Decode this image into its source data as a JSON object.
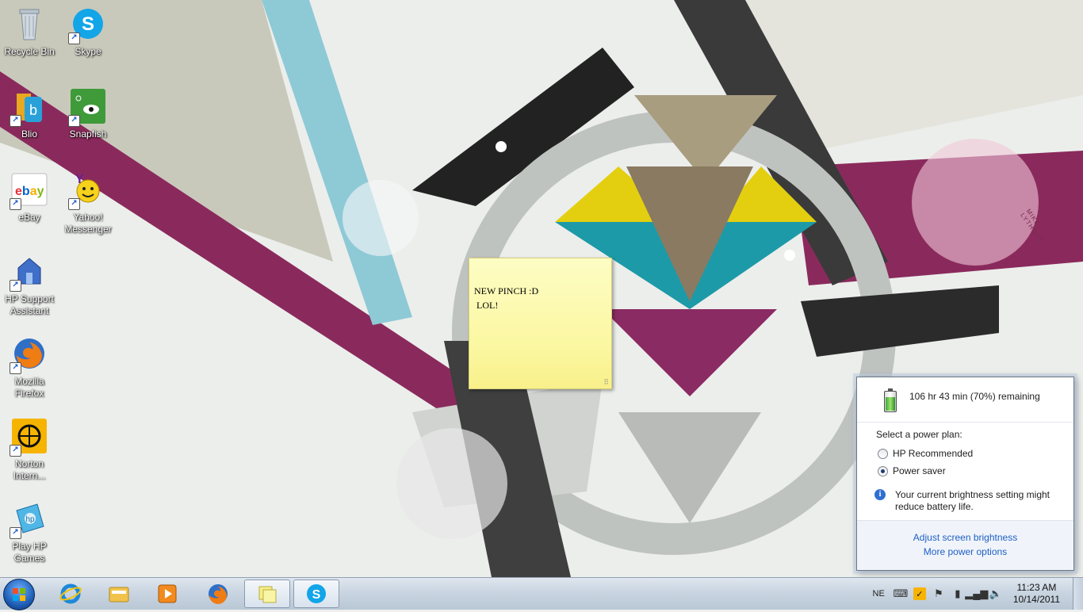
{
  "desktop_icons": [
    {
      "label": "Recycle Bin",
      "icon": "recycle-bin-icon"
    },
    {
      "label": "Skype",
      "icon": "skype-icon"
    },
    {
      "label": "Blio",
      "icon": "blio-icon"
    },
    {
      "label": "Snapfish",
      "icon": "snapfish-icon"
    },
    {
      "label": "eBay",
      "icon": "ebay-icon"
    },
    {
      "label": "Yahoo!\nMessenger",
      "icon": "yahoo-messenger-icon"
    },
    {
      "label": "HP Support\nAssistant",
      "icon": "hp-support-icon"
    },
    {
      "label": "Mozilla\nFirefox",
      "icon": "firefox-icon"
    },
    {
      "label": "Norton\nIntern...",
      "icon": "norton-icon"
    },
    {
      "label": "Play HP\nGames",
      "icon": "hp-games-icon"
    }
  ],
  "sticky_note": {
    "text": "NEW PINCH :D\n LOL!"
  },
  "wallpaper": {
    "signature": "MIKE LYTHGOE"
  },
  "power_flyout": {
    "remaining": "106 hr 43 min (70%) remaining",
    "battery_percent": 70,
    "select_label": "Select a power plan:",
    "plans": [
      {
        "label": "HP Recommended",
        "selected": false
      },
      {
        "label": "Power saver",
        "selected": true
      }
    ],
    "info_text": "Your current brightness setting might reduce battery life.",
    "link_brightness": "Adjust screen brightness",
    "link_more": "More power options"
  },
  "taskbar": {
    "pinned": [
      "internet-explorer-icon",
      "windows-explorer-icon",
      "media-player-icon",
      "firefox-icon",
      "sticky-notes-icon",
      "skype-icon"
    ],
    "tray": {
      "language": "NE",
      "time": "11:23 AM",
      "date": "10/14/2011"
    }
  },
  "colors": {
    "accent": "#1f5fc4",
    "taskbar": "#c9d5e1",
    "sticky": "#fbf7a0"
  }
}
